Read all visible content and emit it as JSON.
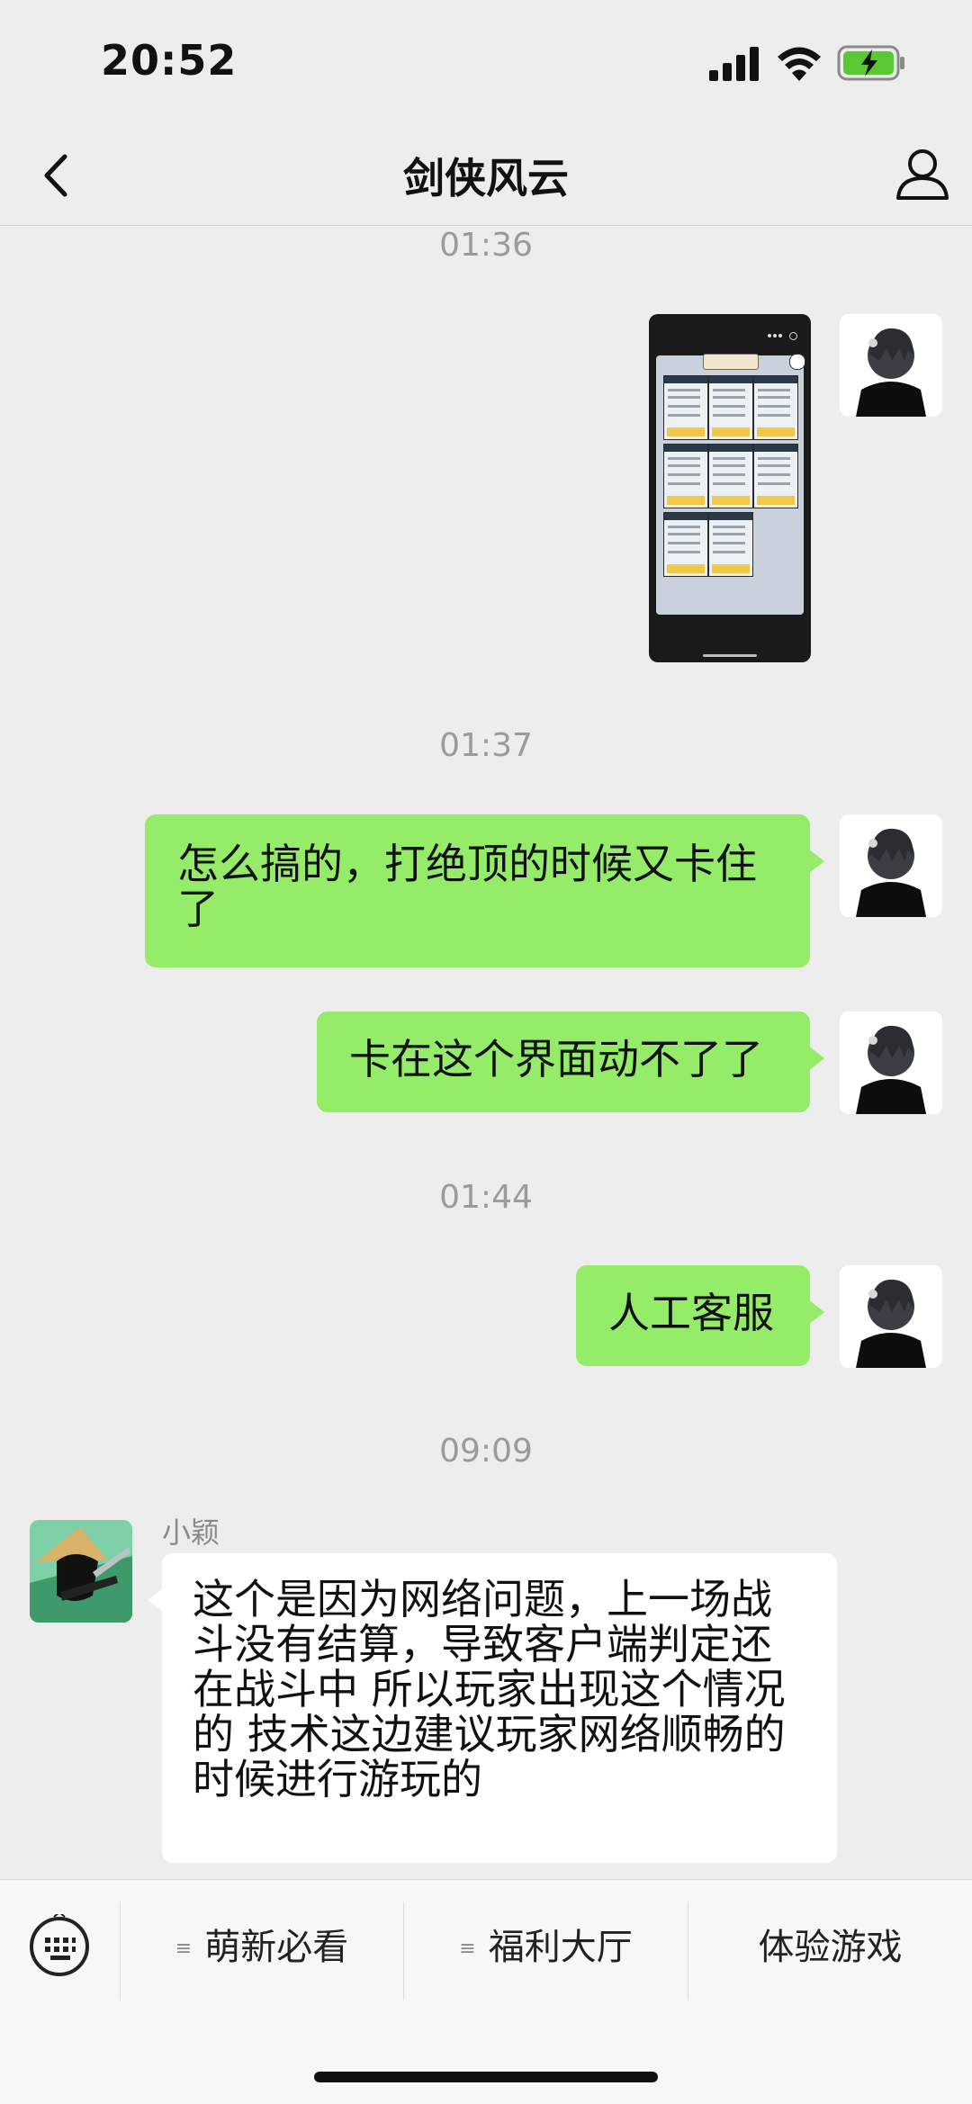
{
  "status_bar": {
    "time": "20:52"
  },
  "header": {
    "title": "剑侠风云"
  },
  "messages": [
    {
      "type": "timestamp",
      "text": "01:36"
    },
    {
      "type": "image",
      "side": "right"
    },
    {
      "type": "timestamp",
      "text": "01:37"
    },
    {
      "type": "text",
      "side": "right",
      "lines": [
        "怎么搞的，打绝顶的时候又卡住",
        "了"
      ]
    },
    {
      "type": "text",
      "side": "right",
      "text": "卡在这个界面动不了了"
    },
    {
      "type": "timestamp",
      "text": "01:44"
    },
    {
      "type": "text",
      "side": "right",
      "text": "人工客服"
    },
    {
      "type": "timestamp",
      "text": "09:09"
    },
    {
      "type": "text",
      "side": "left",
      "sender": "小颖",
      "lines": [
        "这个是因为网络问题，上一场战",
        "斗没有结算，导致客户端判定还",
        "在战斗中 所以玩家出现这个情况",
        "的 技术这边建议玩家网络顺畅的",
        "时候进行游玩的"
      ]
    }
  ],
  "bottom_menu": {
    "items": [
      {
        "label": "萌新必看",
        "has_submenu": true
      },
      {
        "label": "福利大厅",
        "has_submenu": true
      },
      {
        "label": "体验游戏",
        "has_submenu": false
      }
    ]
  },
  "colors": {
    "outgoing_bubble": "#95ec69",
    "incoming_bubble": "#ffffff",
    "background": "#ededed"
  }
}
